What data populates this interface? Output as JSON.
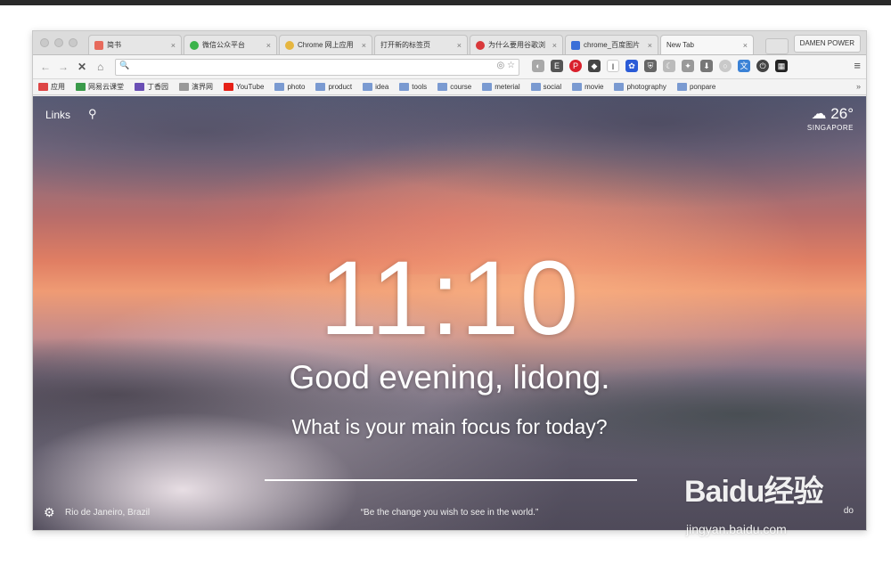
{
  "browser": {
    "tabs": [
      {
        "label": "简书",
        "favicon_color": "#e76a5c",
        "active": false
      },
      {
        "label": "微信公众平台",
        "favicon_color": "#3bb34a",
        "active": false
      },
      {
        "label": "Chrome 网上应用",
        "favicon_color": "#e6b640",
        "active": false
      },
      {
        "label": "打开新的标签页",
        "favicon_color": "#cccccc",
        "active": false
      },
      {
        "label": "为什么要用谷歌浏",
        "favicon_color": "#d9383a",
        "active": false
      },
      {
        "label": "chrome_百度图片",
        "favicon_color": "#3a6fd8",
        "active": false
      },
      {
        "label": "New Tab",
        "favicon_color": "#f7f7f7",
        "active": true
      }
    ],
    "tab_close_glyph": "×",
    "profile_label": "DAMEN POWER",
    "omnibox_value": "",
    "bookmarks": [
      {
        "label": "应用",
        "color": "#d44"
      },
      {
        "label": "网易云课堂",
        "color": "#3a9a4a"
      },
      {
        "label": "丁香园",
        "color": "#6a4fb5"
      },
      {
        "label": "演界网",
        "color": "#999999"
      },
      {
        "label": "YouTube",
        "color": "#e62117"
      },
      {
        "label": "photo",
        "color": "#7a9ad1"
      },
      {
        "label": "product",
        "color": "#7a9ad1"
      },
      {
        "label": "idea",
        "color": "#7a9ad1"
      },
      {
        "label": "tools",
        "color": "#7a9ad1"
      },
      {
        "label": "course",
        "color": "#7a9ad1"
      },
      {
        "label": "meterial",
        "color": "#7a9ad1"
      },
      {
        "label": "social",
        "color": "#7a9ad1"
      },
      {
        "label": "movie",
        "color": "#7a9ad1"
      },
      {
        "label": "photography",
        "color": "#7a9ad1"
      },
      {
        "label": "ponpare",
        "color": "#7a9ad1"
      }
    ],
    "bookmarks_more": "»"
  },
  "newtab": {
    "links_label": "Links",
    "temperature": "26°",
    "weather_location": "SINGAPORE",
    "time": "11:10",
    "greeting": "Good evening, lidong.",
    "focus_question": "What is your main focus for today?",
    "focus_value": "",
    "photo_location": "Rio de Janeiro, Brazil",
    "quote": "“Be the change you wish to see in the world.”",
    "todo_label": "do"
  },
  "watermark": {
    "brand": "Baidu经验",
    "url": "jingyan.baidu.com"
  },
  "colors": {
    "accent_text": "#ffffff",
    "window_chrome": "#dcdcdc"
  }
}
